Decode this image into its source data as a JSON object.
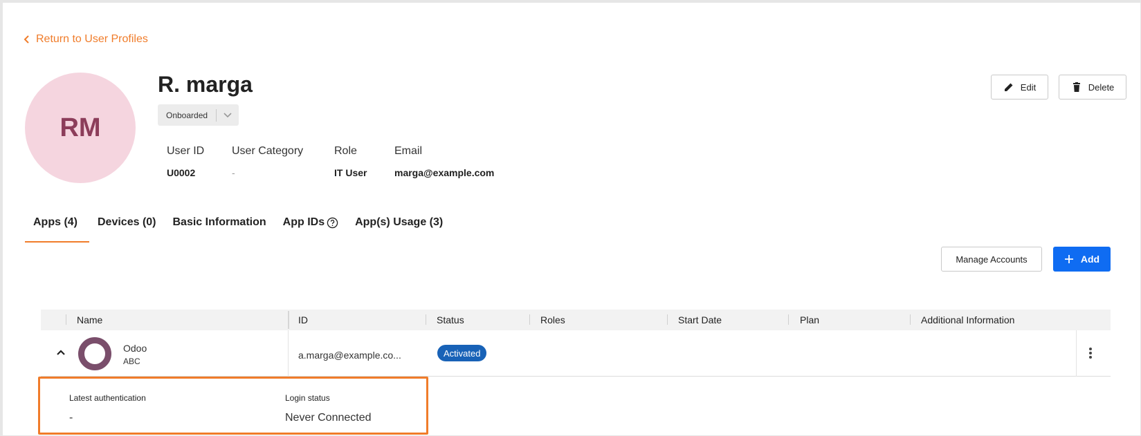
{
  "back_link": {
    "label": "Return to User Profiles"
  },
  "profile": {
    "initials": "RM",
    "name": "R. marga",
    "status": "Onboarded"
  },
  "info": {
    "user_id": {
      "label": "User ID",
      "value": "U0002"
    },
    "category": {
      "label": "User Category",
      "value": "-"
    },
    "role": {
      "label": "Role",
      "value": "IT User"
    },
    "email": {
      "label": "Email",
      "value": "marga@example.com"
    }
  },
  "actions": {
    "edit": "Edit",
    "delete": "Delete"
  },
  "tabs": [
    {
      "label": "Apps (4)",
      "active": true
    },
    {
      "label": "Devices (0)"
    },
    {
      "label": "Basic Information"
    },
    {
      "label": "App IDs"
    },
    {
      "label": "App(s) Usage (3)"
    }
  ],
  "toolbar": {
    "manage_accounts": "Manage Accounts",
    "add": "Add"
  },
  "table": {
    "columns": [
      "Name",
      "ID",
      "Status",
      "Roles",
      "Start Date",
      "Plan",
      "Additional Information"
    ],
    "rows": [
      {
        "name": "Odoo",
        "subtitle": "ABC",
        "id": "a.marga@example.co...",
        "status": "Activated",
        "roles": "",
        "start_date": "",
        "plan": "",
        "additional": ""
      }
    ]
  },
  "details": {
    "latest_auth": {
      "label": "Latest authentication",
      "value": "-"
    },
    "login_status": {
      "label": "Login status",
      "value": "Never Connected"
    }
  },
  "colors": {
    "accent": "#f07c2a",
    "primary": "#0f6cf2",
    "badge": "#1862b7",
    "avatar_bg": "#f5d5df",
    "avatar_text": "#8c3d5a"
  },
  "icons": [
    "chevron-left-icon",
    "chevron-down-icon",
    "pencil-icon",
    "trash-icon",
    "help-circle-icon",
    "plus-icon",
    "chevron-up-icon",
    "kebab-icon",
    "app-logo"
  ]
}
